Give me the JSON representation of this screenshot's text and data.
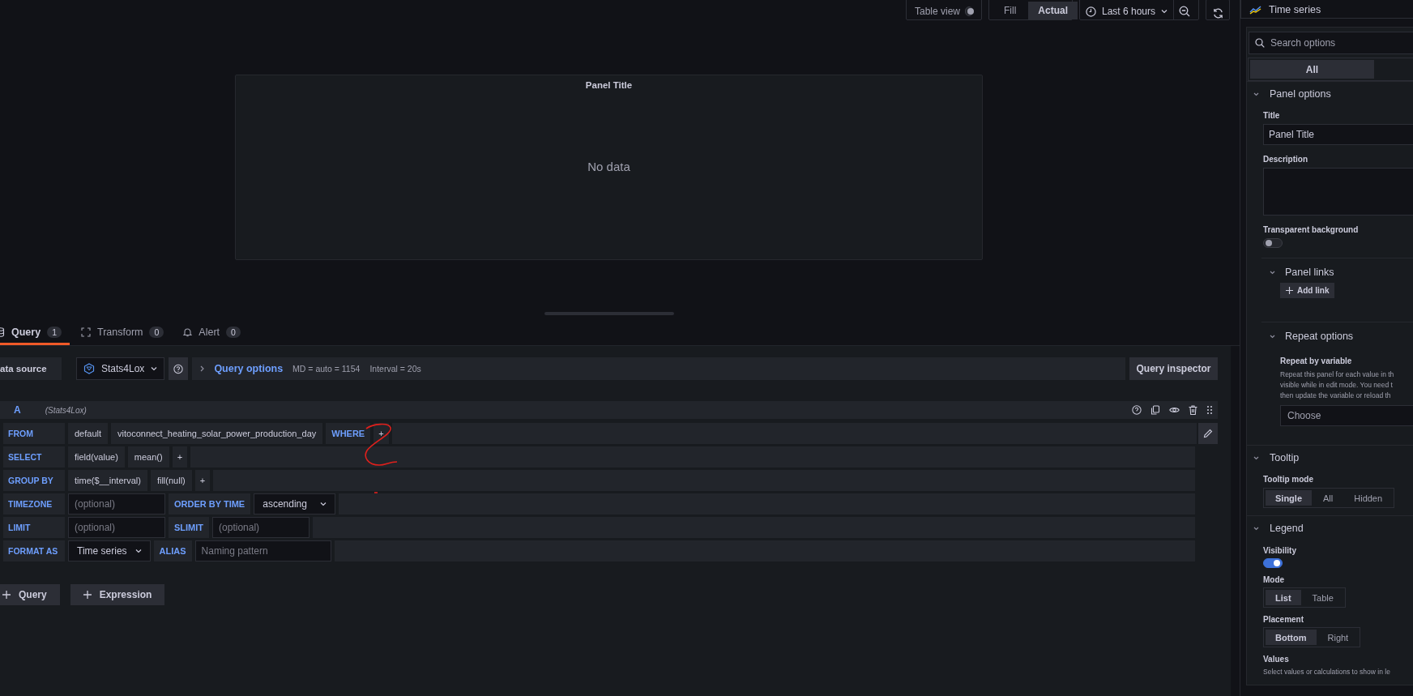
{
  "toolbar": {
    "table_view": {
      "label": "Table view",
      "on": false
    },
    "view_modes": [
      {
        "label": "Fill",
        "selected": false
      },
      {
        "label": "Actual",
        "selected": true
      }
    ],
    "time_range": "Last 6 hours"
  },
  "panel": {
    "title": "Panel Title",
    "message": "No data"
  },
  "tabs": [
    {
      "label": "Query",
      "count": "1",
      "selected": true
    },
    {
      "label": "Transform",
      "count": "0",
      "selected": false
    },
    {
      "label": "Alert",
      "count": "0",
      "selected": false
    }
  ],
  "data_source": {
    "label": "ata source",
    "name": "Stats4Lox"
  },
  "query_options": {
    "label": "Query options",
    "md": "MD = auto = 1154",
    "interval": "Interval = 20s"
  },
  "query_inspector": "Query inspector",
  "query": {
    "ref": "A",
    "source": "(Stats4Lox)",
    "rows": [
      {
        "label": "FROM",
        "editable": true,
        "parts": [
          {
            "kind": "segment",
            "text": "default"
          },
          {
            "kind": "segment",
            "text": "vitoconnect_heating_solar_power_production_day"
          },
          {
            "kind": "keyword",
            "text": "WHERE"
          },
          {
            "kind": "plus",
            "text": "+"
          }
        ]
      },
      {
        "label": "SELECT",
        "editable": false,
        "parts": [
          {
            "kind": "segment",
            "text": "field(value)"
          },
          {
            "kind": "segment",
            "text": "mean()"
          },
          {
            "kind": "plus",
            "text": "+"
          }
        ]
      },
      {
        "label": "GROUP BY",
        "editable": false,
        "parts": [
          {
            "kind": "segment",
            "text": "time($__interval)"
          },
          {
            "kind": "segment",
            "text": "fill(null)"
          },
          {
            "kind": "plus",
            "text": "+"
          }
        ]
      },
      {
        "label": "TIMEZONE",
        "editable": false,
        "parts": [
          {
            "kind": "input",
            "placeholder": "(optional)"
          },
          {
            "kind": "keyword",
            "text": "ORDER BY TIME"
          },
          {
            "kind": "select",
            "text": "ascending"
          }
        ]
      },
      {
        "label": "LIMIT",
        "editable": false,
        "parts": [
          {
            "kind": "input",
            "placeholder": "(optional)"
          },
          {
            "kind": "keyword",
            "text": "SLIMIT"
          },
          {
            "kind": "input",
            "placeholder": "(optional)"
          }
        ]
      },
      {
        "label": "FORMAT AS",
        "editable": false,
        "parts": [
          {
            "kind": "select",
            "text": "Time series"
          },
          {
            "kind": "keyword",
            "text": "ALIAS"
          },
          {
            "kind": "input",
            "placeholder": "Naming pattern"
          }
        ]
      }
    ]
  },
  "add_buttons": [
    "Query",
    "Expression"
  ],
  "options_pane": {
    "visualization": "Time series",
    "search_placeholder": "Search options",
    "filter_tabs": [
      {
        "label": "All",
        "selected": true
      }
    ],
    "sections": [
      {
        "title": "Panel options",
        "expanded": true,
        "fields": [
          {
            "kind": "input",
            "label": "Title",
            "value": "Panel Title"
          },
          {
            "kind": "textarea",
            "label": "Description"
          },
          {
            "kind": "switch",
            "label": "Transparent background",
            "on": false
          },
          {
            "kind": "subsection",
            "title": "Panel links",
            "expanded": true,
            "fields": [
              {
                "kind": "button",
                "label": "Add link"
              }
            ]
          },
          {
            "kind": "subsection",
            "title": "Repeat options",
            "expanded": true,
            "fields": [
              {
                "kind": "select",
                "label": "Repeat by variable",
                "lines": [
                  "Repeat this panel for each value in th",
                  "visible while in edit mode. You need t",
                  "then update the variable or reload th"
                ],
                "placeholder": "Choose"
              }
            ]
          }
        ]
      },
      {
        "title": "Tooltip",
        "expanded": true,
        "fields": [
          {
            "kind": "radio",
            "label": "Tooltip mode",
            "options": [
              {
                "label": "Single",
                "selected": true
              },
              {
                "label": "All",
                "selected": false
              },
              {
                "label": "Hidden",
                "selected": false
              }
            ]
          }
        ]
      },
      {
        "title": "Legend",
        "expanded": true,
        "fields": [
          {
            "kind": "switch",
            "label": "Visibility",
            "on": true
          },
          {
            "kind": "radio",
            "label": "Mode",
            "options": [
              {
                "label": "List",
                "selected": true
              },
              {
                "label": "Table",
                "selected": false
              }
            ]
          },
          {
            "kind": "radio",
            "label": "Placement",
            "options": [
              {
                "label": "Bottom",
                "selected": true
              },
              {
                "label": "Right",
                "selected": false
              }
            ]
          },
          {
            "kind": "text",
            "label": "Values",
            "lines": [
              "Select values or calculations to show in le"
            ]
          }
        ]
      }
    ]
  }
}
